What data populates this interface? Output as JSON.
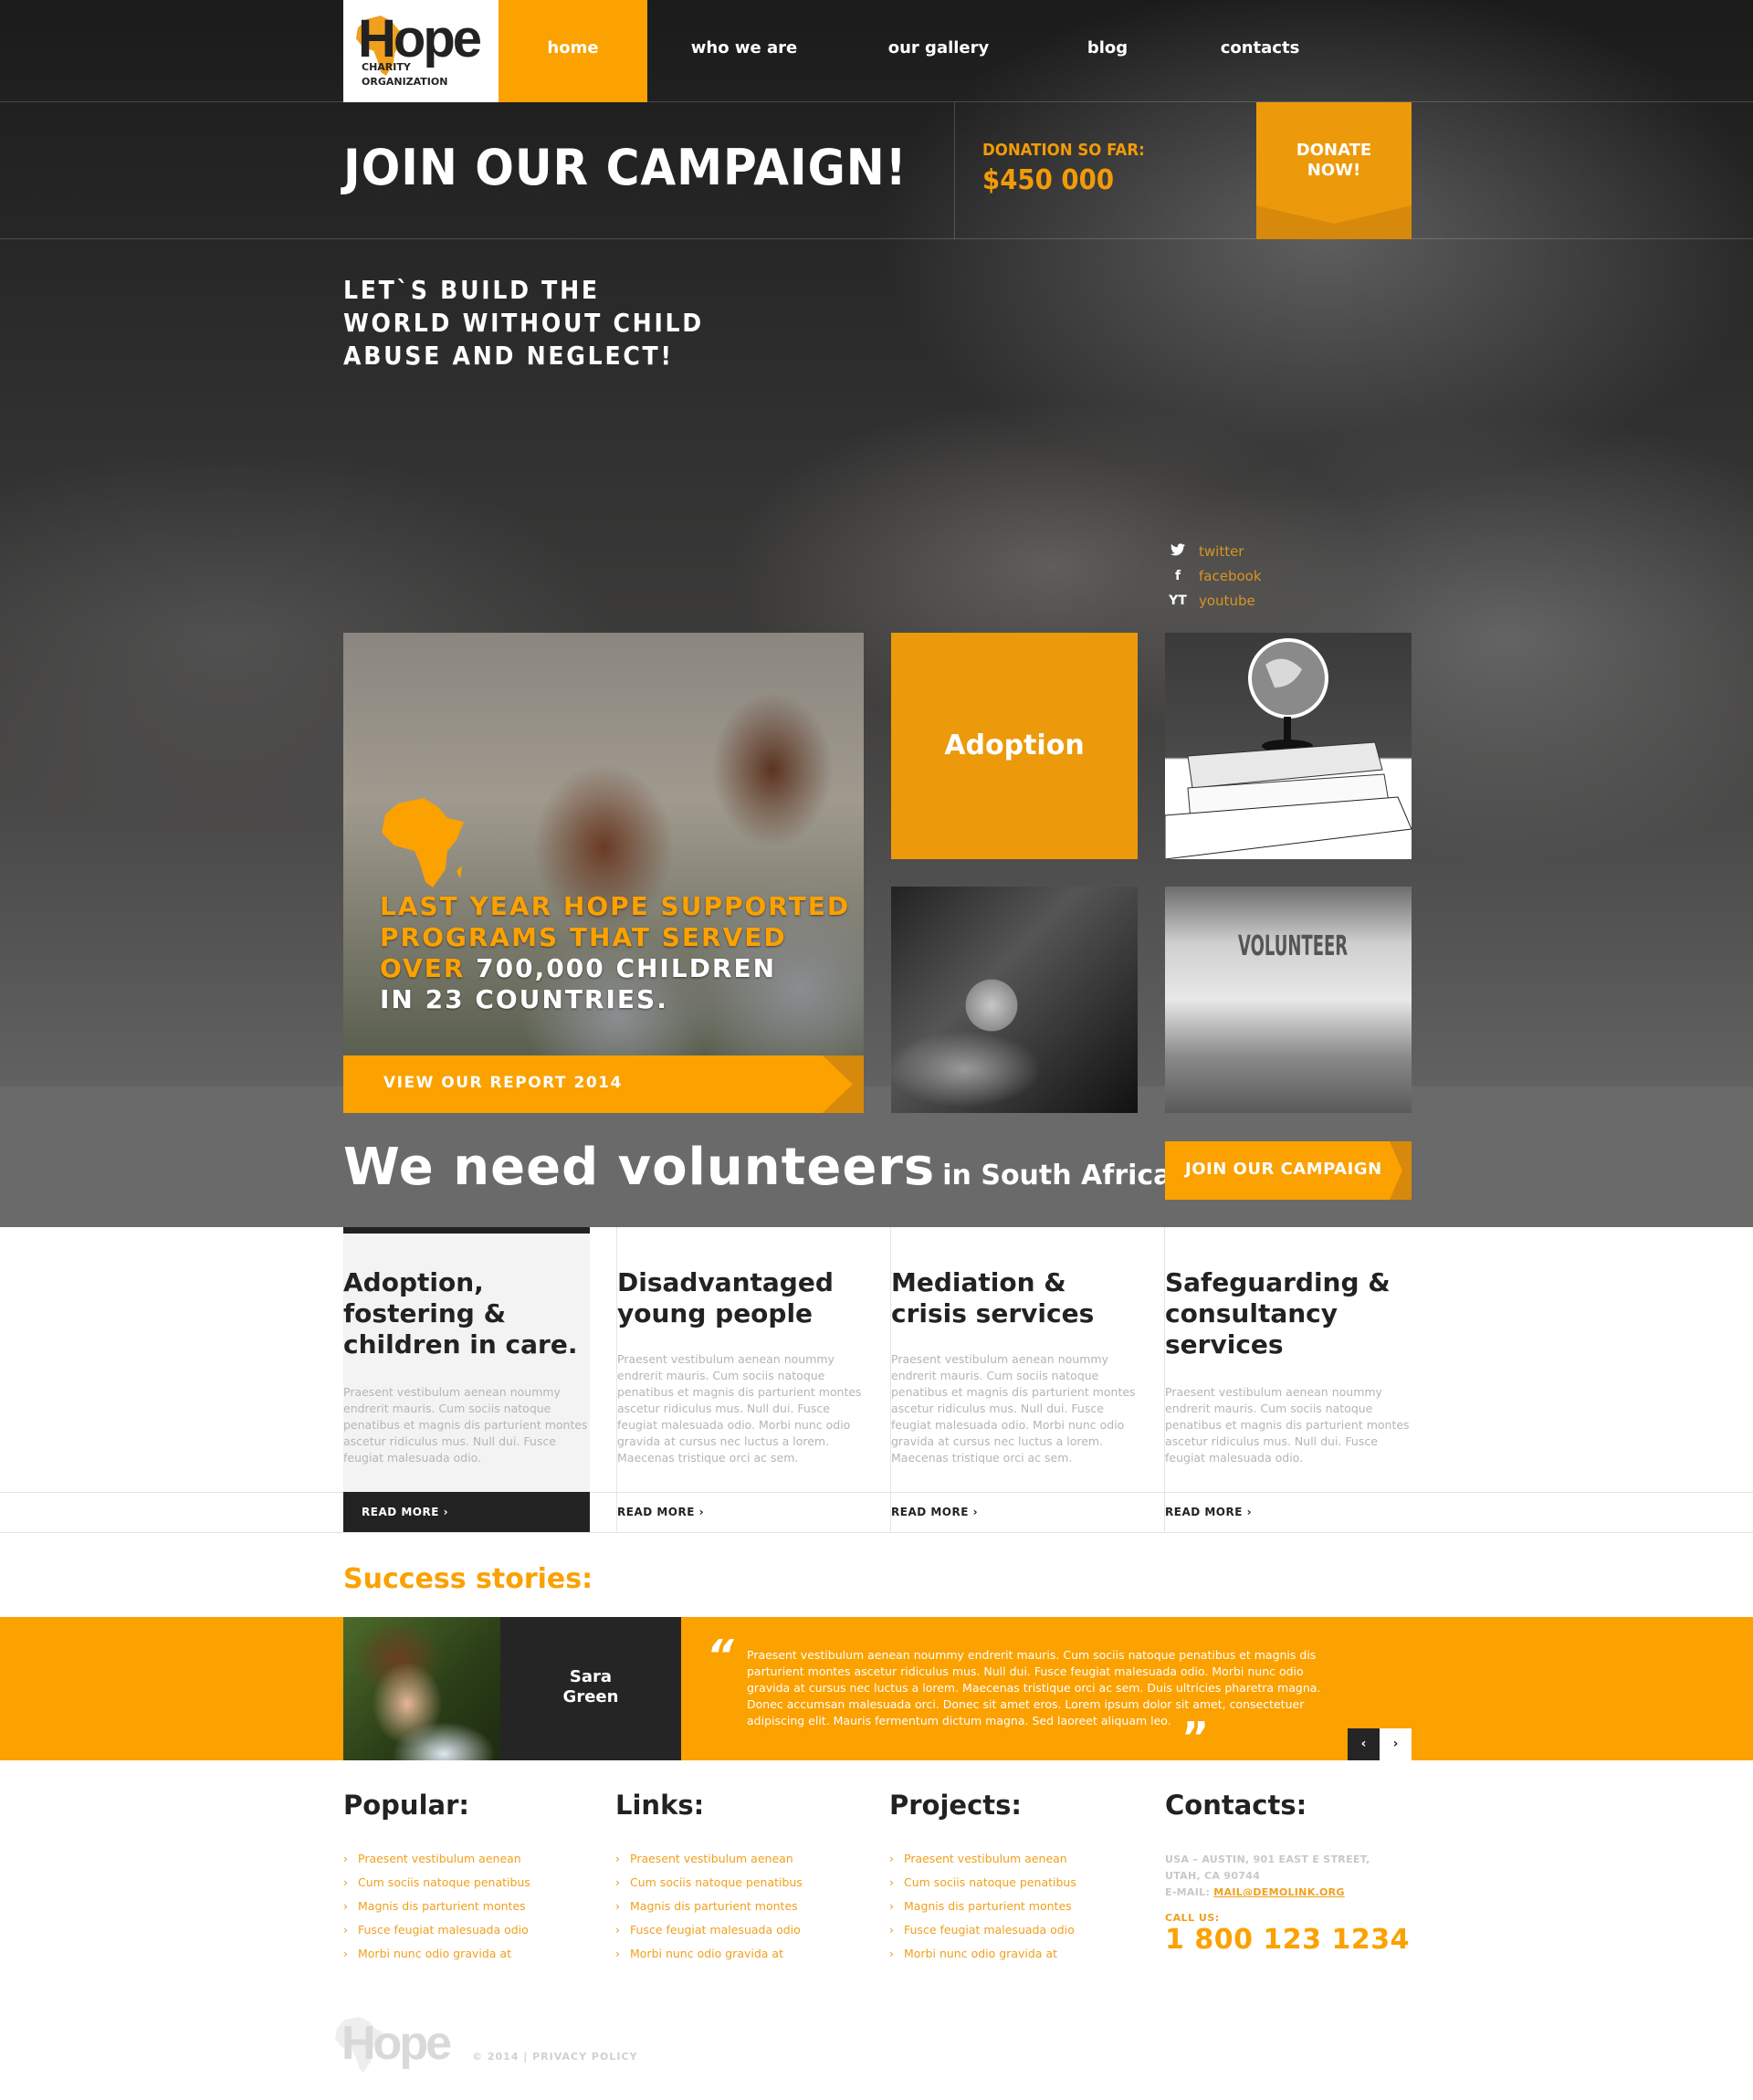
{
  "colors": {
    "accent": "#fba100",
    "accent_dark": "#d88a06",
    "dark": "#252525",
    "muted_text": "#b5b5b5"
  },
  "brand": {
    "name": "Hope",
    "sub_line1": "CHARITY",
    "sub_line2": "ORGANIZATION"
  },
  "nav": {
    "items": [
      {
        "label": "home",
        "active": true
      },
      {
        "label": "who we are",
        "active": false
      },
      {
        "label": "our gallery",
        "active": false
      },
      {
        "label": "blog",
        "active": false
      },
      {
        "label": "contacts",
        "active": false
      }
    ]
  },
  "campaign": {
    "title": "JOIN OUR CAMPAIGN!",
    "donation_label": "DONATION SO FAR:",
    "donation_value": "$450 000",
    "donate_line1": "DONATE",
    "donate_line2": "NOW!"
  },
  "tagline": {
    "line1": "LET`S BUILD THE",
    "line2": "WORLD WITHOUT CHILD",
    "line3": "ABUSE AND NEGLECT!"
  },
  "social": [
    {
      "icon": "twitter-icon",
      "glyph": "🐦",
      "label": "twitter"
    },
    {
      "icon": "facebook-icon",
      "glyph": "f",
      "label": "facebook"
    },
    {
      "icon": "youtube-icon",
      "glyph": "YT",
      "label": "youtube"
    }
  ],
  "feature": {
    "line1": "LAST YEAR HOPE SUPPORTED",
    "line2": "PROGRAMS THAT SERVED",
    "line3_highlight": "OVER",
    "line3_rest": " 700,000 CHILDREN",
    "line4": "IN 23 COUNTRIES.",
    "button_label": "VIEW OUR REPORT 2014"
  },
  "tiles": {
    "adoption_label": "Adoption",
    "volunteer_shirt_text": "VOLUNTEER"
  },
  "volunteers": {
    "big": "We need volunteers",
    "small": "in South Africa",
    "button_label": "JOIN OUR CAMPAIGN"
  },
  "services": [
    {
      "title": "Adoption, fostering & children in care.",
      "body": "Praesent vestibulum aenean noummy endrerit mauris. Cum sociis natoque penatibus et magnis dis parturient montes ascetur ridiculus mus. Null dui. Fusce feugiat malesuada odio.",
      "read_more": "READ MORE ›",
      "active": true
    },
    {
      "title": "Disadvantaged young people",
      "body": "Praesent vestibulum aenean noummy endrerit mauris. Cum sociis natoque penatibus et magnis dis parturient montes ascetur ridiculus mus. Null dui. Fusce feugiat malesuada odio. Morbi nunc odio gravida at cursus nec luctus a lorem. Maecenas tristique orci ac sem.",
      "read_more": "READ MORE ›",
      "active": false
    },
    {
      "title": "Mediation & crisis services",
      "body": "Praesent vestibulum aenean noummy endrerit mauris. Cum sociis natoque penatibus et magnis dis parturient montes ascetur ridiculus mus. Null dui. Fusce feugiat malesuada odio. Morbi nunc odio gravida at cursus nec luctus a lorem. Maecenas tristique orci ac sem.",
      "read_more": "READ MORE ›",
      "active": false
    },
    {
      "title": "Safeguarding & consultancy services",
      "body": "Praesent vestibulum aenean noummy endrerit mauris. Cum sociis natoque penatibus et magnis dis parturient montes ascetur ridiculus mus. Null dui. Fusce feugiat malesuada odio.",
      "read_more": "READ MORE ›",
      "active": false
    }
  ],
  "success": {
    "title": "Success stories:",
    "name_line1": "Sara",
    "name_line2": "Green",
    "quote": "Praesent vestibulum aenean noummy endrerit mauris. Cum sociis natoque penatibus et magnis dis parturient montes ascetur ridiculus mus. Null dui. Fusce feugiat malesuada odio. Morbi nunc odio gravida at cursus nec luctus a lorem. Maecenas tristique orci ac sem. Duis ultricies pharetra magna. Donec accumsan malesuada orci. Donec sit amet eros. Lorem ipsum dolor sit amet, consectetuer adipiscing elit. Mauris fermentum dictum magna. Sed laoreet aliquam leo.",
    "quote_open": "“",
    "quote_close": "”",
    "prev": "‹",
    "next": "›"
  },
  "footer": {
    "popular": {
      "title": "Popular:",
      "items": [
        "Praesent vestibulum aenean",
        "Cum sociis natoque penatibus",
        "Magnis dis parturient montes",
        "Fusce feugiat malesuada odio",
        "Morbi nunc odio gravida at"
      ]
    },
    "links": {
      "title": "Links:",
      "items": [
        "Praesent vestibulum aenean",
        "Cum sociis natoque penatibus",
        "Magnis dis parturient montes",
        "Fusce feugiat malesuada odio",
        "Morbi nunc odio gravida at"
      ]
    },
    "projects": {
      "title": "Projects:",
      "items": [
        "Praesent vestibulum aenean",
        "Cum sociis natoque penatibus",
        "Magnis dis parturient montes",
        "Fusce feugiat malesuada odio",
        "Morbi nunc odio gravida at"
      ]
    },
    "contacts": {
      "title": "Contacts:",
      "address_line1": "USA – AUSTIN, 901 EAST E STREET,",
      "address_line2": "UTAH, CA 90744",
      "email_label": "E-MAIL: ",
      "email": "MAIL@DEMOLINK.ORG",
      "call_label": "CALL US:",
      "phone": "1 800 123 1234"
    },
    "chevron": "›"
  },
  "bottom": {
    "logo": "Hope",
    "copyright": "© 2014 | ",
    "privacy": "PRIVACY POLICY"
  }
}
